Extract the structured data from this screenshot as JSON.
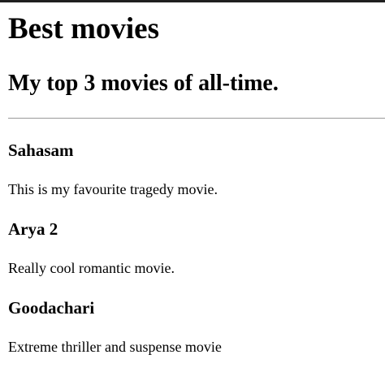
{
  "page": {
    "title": "Best movies",
    "subtitle": "My top 3 movies of all-time."
  },
  "movies": [
    {
      "title": "Sahasam",
      "description": "This is my favourite tragedy movie."
    },
    {
      "title": "Arya 2",
      "description": "Really cool romantic movie."
    },
    {
      "title": "Goodachari",
      "description": "Extreme thriller and suspense movie"
    }
  ]
}
